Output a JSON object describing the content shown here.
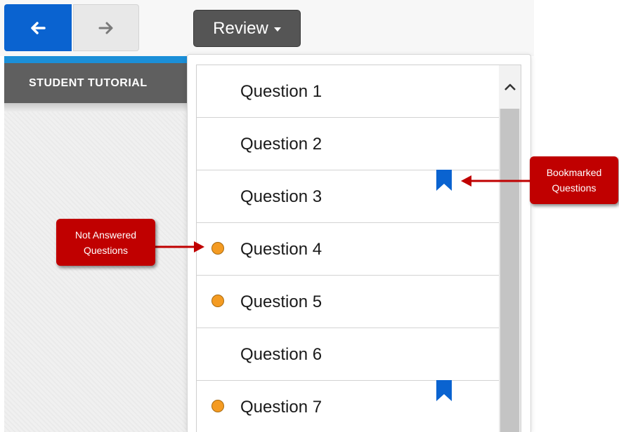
{
  "toolbar": {
    "back_icon": "arrow-left-icon",
    "forward_icon": "arrow-right-icon",
    "review_label": "Review"
  },
  "tutorial": {
    "title": "STUDENT TUTORIAL"
  },
  "questions": [
    {
      "label": "Question 1",
      "not_answered": false,
      "bookmarked": false
    },
    {
      "label": "Question 2",
      "not_answered": false,
      "bookmarked": false
    },
    {
      "label": "Question 3",
      "not_answered": false,
      "bookmarked": true
    },
    {
      "label": "Question 4",
      "not_answered": true,
      "bookmarked": false
    },
    {
      "label": "Question 5",
      "not_answered": true,
      "bookmarked": false
    },
    {
      "label": "Question 6",
      "not_answered": false,
      "bookmarked": false
    },
    {
      "label": "Question 7",
      "not_answered": true,
      "bookmarked": true
    }
  ],
  "callouts": {
    "bookmarked": {
      "line1": "Bookmarked",
      "line2": "Questions"
    },
    "not_answered": {
      "line1": "Not Answered",
      "line2": "Questions"
    }
  },
  "colors": {
    "accent_blue": "#0a63d0",
    "not_answered_dot": "#f49b22",
    "bookmark": "#0a63d0",
    "callout_red": "#c00000"
  }
}
